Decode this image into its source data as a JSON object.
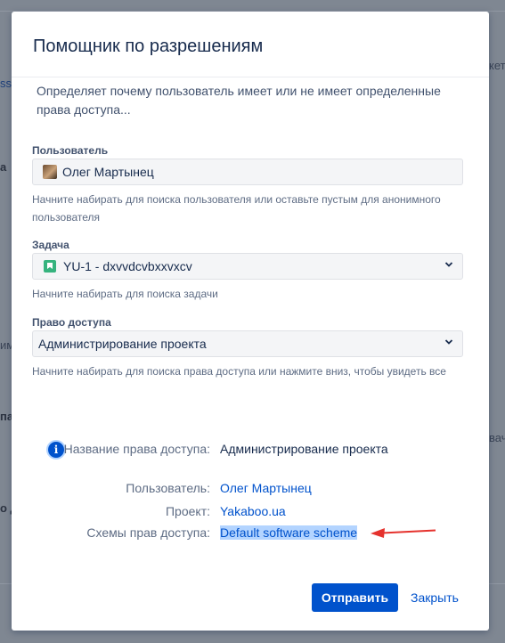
{
  "dialog": {
    "title": "Помощник по разрешениям",
    "description": "Определяет почему пользователь имеет или не имеет определенные права доступа..."
  },
  "form": {
    "user": {
      "label": "Пользователь",
      "value": "Олег Мартынец",
      "help": "Начните набирать для поиска пользователя или оставьте пустым для анонимного пользователя"
    },
    "issue": {
      "label": "Задача",
      "value": "YU-1 - dxvvdcvbxxvxcv",
      "help": "Начните набирать для поиска задачи"
    },
    "permission": {
      "label": "Право доступа",
      "value": "Администрирование проекта",
      "help": "Начните набирать для поиска права доступа или нажмите вниз, чтобы увидеть все"
    }
  },
  "result": {
    "permission_name_label": "Название права доступа:",
    "permission_name_value": "Администрирование проекта",
    "user_label": "Пользователь:",
    "user_value": "Олег Мартынец",
    "project_label": "Проект:",
    "project_value": "Yakaboo.ua",
    "schemes_label": "Схемы прав доступа:",
    "schemes_value": "Default software scheme"
  },
  "buttons": {
    "submit": "Отправить",
    "close": "Закрыть"
  },
  "background": {
    "frag_ss": "ss",
    "frag_a": "а",
    "frag_mi": "ими",
    "frag_pa": "па",
    "frag_od": "о д",
    "frag_ket": "кет",
    "frag_vache": "вачє"
  },
  "colors": {
    "primary": "#0052cc",
    "story_icon": "#36b37e",
    "arrow": "#e5322d",
    "selection": "#b3d4ff"
  },
  "icons": {
    "info": "info-icon",
    "chevron": "chevron-down-icon",
    "story": "story-icon",
    "avatar": "avatar"
  }
}
